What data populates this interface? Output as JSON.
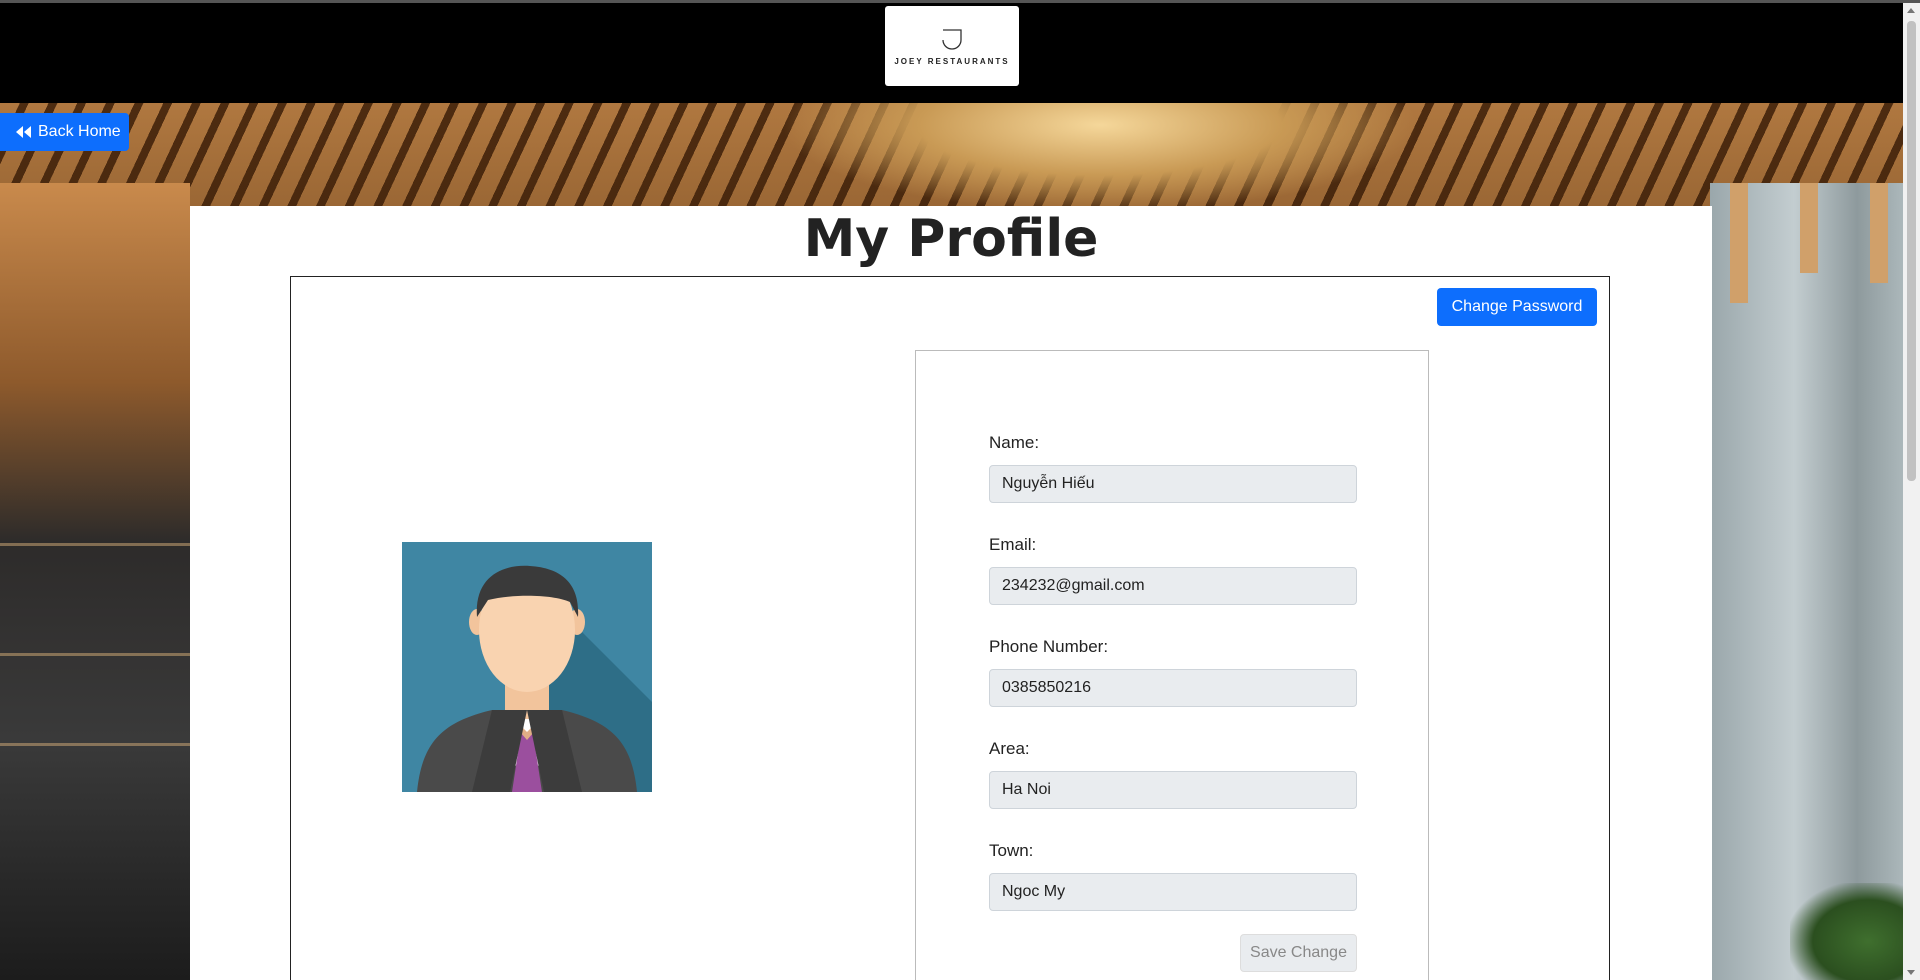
{
  "header": {
    "logo_text": "JOEY RESTAURANTS"
  },
  "nav": {
    "back_label": "Back Home"
  },
  "page": {
    "title": "My Profile"
  },
  "actions": {
    "change_password_label": "Change Password",
    "save_label": "Save Change"
  },
  "profile": {
    "fields": [
      {
        "label": "Name:",
        "value": "Nguyễn Hiếu"
      },
      {
        "label": "Email:",
        "value": "234232@gmail.com"
      },
      {
        "label": "Phone Number:",
        "value": "0385850216"
      },
      {
        "label": "Area:",
        "value": "Ha Noi"
      },
      {
        "label": "Town:",
        "value": "Ngoc My"
      }
    ]
  },
  "icons": {
    "back": "double-chevron-left-icon",
    "avatar": "businessman-avatar-icon"
  },
  "colors": {
    "primary": "#0d6efd",
    "header_bg": "#000000",
    "input_bg": "#e9ecef"
  }
}
